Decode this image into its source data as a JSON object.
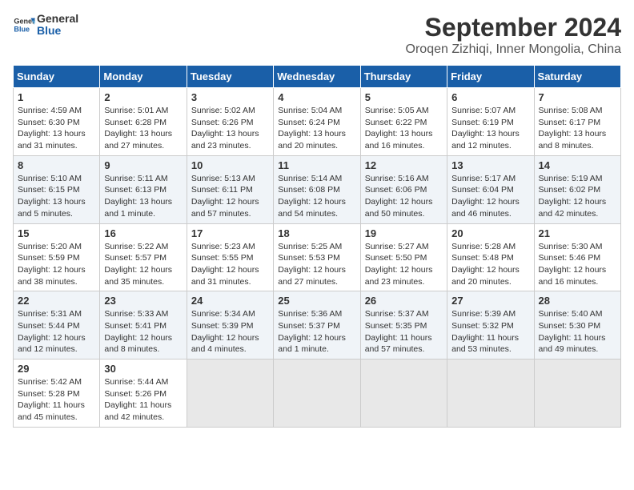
{
  "header": {
    "logo_line1": "General",
    "logo_line2": "Blue",
    "title": "September 2024",
    "subtitle": "Oroqen Zizhiqi, Inner Mongolia, China"
  },
  "calendar": {
    "columns": [
      "Sunday",
      "Monday",
      "Tuesday",
      "Wednesday",
      "Thursday",
      "Friday",
      "Saturday"
    ],
    "rows": [
      [
        {
          "day": "1",
          "info": "Sunrise: 4:59 AM\nSunset: 6:30 PM\nDaylight: 13 hours\nand 31 minutes."
        },
        {
          "day": "2",
          "info": "Sunrise: 5:01 AM\nSunset: 6:28 PM\nDaylight: 13 hours\nand 27 minutes."
        },
        {
          "day": "3",
          "info": "Sunrise: 5:02 AM\nSunset: 6:26 PM\nDaylight: 13 hours\nand 23 minutes."
        },
        {
          "day": "4",
          "info": "Sunrise: 5:04 AM\nSunset: 6:24 PM\nDaylight: 13 hours\nand 20 minutes."
        },
        {
          "day": "5",
          "info": "Sunrise: 5:05 AM\nSunset: 6:22 PM\nDaylight: 13 hours\nand 16 minutes."
        },
        {
          "day": "6",
          "info": "Sunrise: 5:07 AM\nSunset: 6:19 PM\nDaylight: 13 hours\nand 12 minutes."
        },
        {
          "day": "7",
          "info": "Sunrise: 5:08 AM\nSunset: 6:17 PM\nDaylight: 13 hours\nand 8 minutes."
        }
      ],
      [
        {
          "day": "8",
          "info": "Sunrise: 5:10 AM\nSunset: 6:15 PM\nDaylight: 13 hours\nand 5 minutes."
        },
        {
          "day": "9",
          "info": "Sunrise: 5:11 AM\nSunset: 6:13 PM\nDaylight: 13 hours\nand 1 minute."
        },
        {
          "day": "10",
          "info": "Sunrise: 5:13 AM\nSunset: 6:11 PM\nDaylight: 12 hours\nand 57 minutes."
        },
        {
          "day": "11",
          "info": "Sunrise: 5:14 AM\nSunset: 6:08 PM\nDaylight: 12 hours\nand 54 minutes."
        },
        {
          "day": "12",
          "info": "Sunrise: 5:16 AM\nSunset: 6:06 PM\nDaylight: 12 hours\nand 50 minutes."
        },
        {
          "day": "13",
          "info": "Sunrise: 5:17 AM\nSunset: 6:04 PM\nDaylight: 12 hours\nand 46 minutes."
        },
        {
          "day": "14",
          "info": "Sunrise: 5:19 AM\nSunset: 6:02 PM\nDaylight: 12 hours\nand 42 minutes."
        }
      ],
      [
        {
          "day": "15",
          "info": "Sunrise: 5:20 AM\nSunset: 5:59 PM\nDaylight: 12 hours\nand 38 minutes."
        },
        {
          "day": "16",
          "info": "Sunrise: 5:22 AM\nSunset: 5:57 PM\nDaylight: 12 hours\nand 35 minutes."
        },
        {
          "day": "17",
          "info": "Sunrise: 5:23 AM\nSunset: 5:55 PM\nDaylight: 12 hours\nand 31 minutes."
        },
        {
          "day": "18",
          "info": "Sunrise: 5:25 AM\nSunset: 5:53 PM\nDaylight: 12 hours\nand 27 minutes."
        },
        {
          "day": "19",
          "info": "Sunrise: 5:27 AM\nSunset: 5:50 PM\nDaylight: 12 hours\nand 23 minutes."
        },
        {
          "day": "20",
          "info": "Sunrise: 5:28 AM\nSunset: 5:48 PM\nDaylight: 12 hours\nand 20 minutes."
        },
        {
          "day": "21",
          "info": "Sunrise: 5:30 AM\nSunset: 5:46 PM\nDaylight: 12 hours\nand 16 minutes."
        }
      ],
      [
        {
          "day": "22",
          "info": "Sunrise: 5:31 AM\nSunset: 5:44 PM\nDaylight: 12 hours\nand 12 minutes."
        },
        {
          "day": "23",
          "info": "Sunrise: 5:33 AM\nSunset: 5:41 PM\nDaylight: 12 hours\nand 8 minutes."
        },
        {
          "day": "24",
          "info": "Sunrise: 5:34 AM\nSunset: 5:39 PM\nDaylight: 12 hours\nand 4 minutes."
        },
        {
          "day": "25",
          "info": "Sunrise: 5:36 AM\nSunset: 5:37 PM\nDaylight: 12 hours\nand 1 minute."
        },
        {
          "day": "26",
          "info": "Sunrise: 5:37 AM\nSunset: 5:35 PM\nDaylight: 11 hours\nand 57 minutes."
        },
        {
          "day": "27",
          "info": "Sunrise: 5:39 AM\nSunset: 5:32 PM\nDaylight: 11 hours\nand 53 minutes."
        },
        {
          "day": "28",
          "info": "Sunrise: 5:40 AM\nSunset: 5:30 PM\nDaylight: 11 hours\nand 49 minutes."
        }
      ],
      [
        {
          "day": "29",
          "info": "Sunrise: 5:42 AM\nSunset: 5:28 PM\nDaylight: 11 hours\nand 45 minutes."
        },
        {
          "day": "30",
          "info": "Sunrise: 5:44 AM\nSunset: 5:26 PM\nDaylight: 11 hours\nand 42 minutes."
        },
        {
          "day": "",
          "info": ""
        },
        {
          "day": "",
          "info": ""
        },
        {
          "day": "",
          "info": ""
        },
        {
          "day": "",
          "info": ""
        },
        {
          "day": "",
          "info": ""
        }
      ]
    ]
  }
}
